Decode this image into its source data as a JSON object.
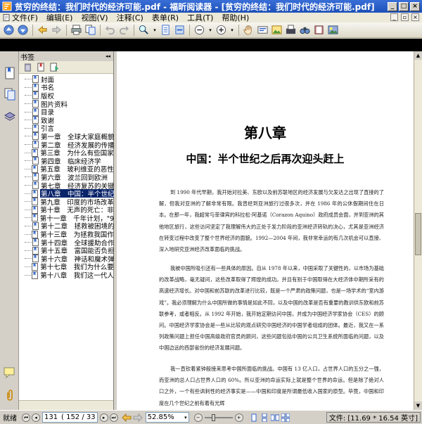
{
  "window": {
    "title": "贫穷的终结：我们时代的经济可能.pdf - 福昕阅读器 - [贫穷的终结：我们时代的经济可能.pdf]"
  },
  "menu": {
    "items": [
      "文件(F)",
      "编辑(E)",
      "视图(V)",
      "注释(C)",
      "表单(R)",
      "工具(T)",
      "帮助(H)"
    ]
  },
  "panel": {
    "header": "书签",
    "collapse_glyph": "◂◂"
  },
  "bookmarks": [
    "封面",
    "书名",
    "版权",
    "图片资料",
    "目录",
    "致谢",
    "引言",
    "第一章　全球大家庭概貌",
    "第二章　经济发展的传播",
    "第三章　为什么有些国家未",
    "第四章　临床经济学",
    "第五章　玻利维亚的恶性通",
    "第六章　波兰回到欧洲",
    "第七章　经济复苏的关键",
    "第八章　中国：半个世纪之",
    "第九章　印度的市场改革：",
    "第十章　无声的死亡：非洲",
    "第十一章　千年计划，\"9·11",
    "第十二章　拯救被困境的",
    "第十三章　为拯救我国作决",
    "第十四章　全球援助合作",
    "第十五章　富国能否负担",
    "第十六章　神话和魔术弹",
    "第十七章　我们为什么要做",
    "第十八章　我们这一代人的"
  ],
  "selected_bookmark": "第八章　中国：半个世纪之",
  "document": {
    "chapter_number": "第八章",
    "chapter_title": "中国：半个世纪之后再次迎头赶上",
    "paragraphs": [
      "到 1990 年代早期，我开始对拉美、东欧以及前苏联地区的经济发展与欠发达之出现了直接的了解，但我对亚洲的了解非常有限。我曾经到亚洲旅行过很多次，并在 1986 年的公休假期间住在日本。在那一年，我超常与菲律宾的科拉松·阿基诺（Corazon Aquino）政府成员会面，并到亚洲的其他地区旅行，这些访问坚定了我理解伟大的正处于发力阶段的亚洲经济转轨的决心，尤其是亚洲经济在转变过程中改变了整个世界经济的面貌。1992—2004 年间，我非常幸运的有几次机会可以直接、深入地研究亚洲经济改革面临的挑战。",
      "我被中国所吸引还有一些具体的原因。自从 1978 年以来，中国采取了关键性的，以市场为基础的改革战略，毫无疑问，这些改革取得了辉煌的成功。并且有别于中国取得在大经济体中期所采有的高速经济增长。对中国和前苏联的改革进行比较，既是一个严肃的政策问题，也是一场学术的“室内游戏”。我必须理解为什么中国所做的事情是如此不同，以及中国的改革是否有重要的教训供东欧和前苏联参考，或者相反。从 1992 年开始，我开始定期访问中国，并成为中国经济学家协会（CES）的顾问。中国经济学家协会是一些从比较的观点研究中国经济的中国学者组成的团体。最近，我又在一系列政策问题上担任中国高级政府官员的顾问，这些问题包括中国的公共卫生系统所面临的问题，以及中国边远的西部省份的经济发展问题。",
      "我一直钦着紧钟般接来思考中国所面临的挑战。中国有 13 亿人口，占世界人口的五分之一强，而亚洲的总人口占世界人口的 60%。所以亚洲的命运实际上就是整个世界的命运。但是除了绝对人口之外，一个有些讽刺性的经济事实是——中国和印度是所谓最低收入国家的原型。毕竟，中国和印度在几个世纪之前有着有光辉"
    ]
  },
  "status": {
    "ready": "就绪",
    "page_current": "131",
    "page_of": "( 152 / 33",
    "zoom": "52.85%",
    "file_size": "文件: [11.69 * 16.54 英寸]"
  }
}
